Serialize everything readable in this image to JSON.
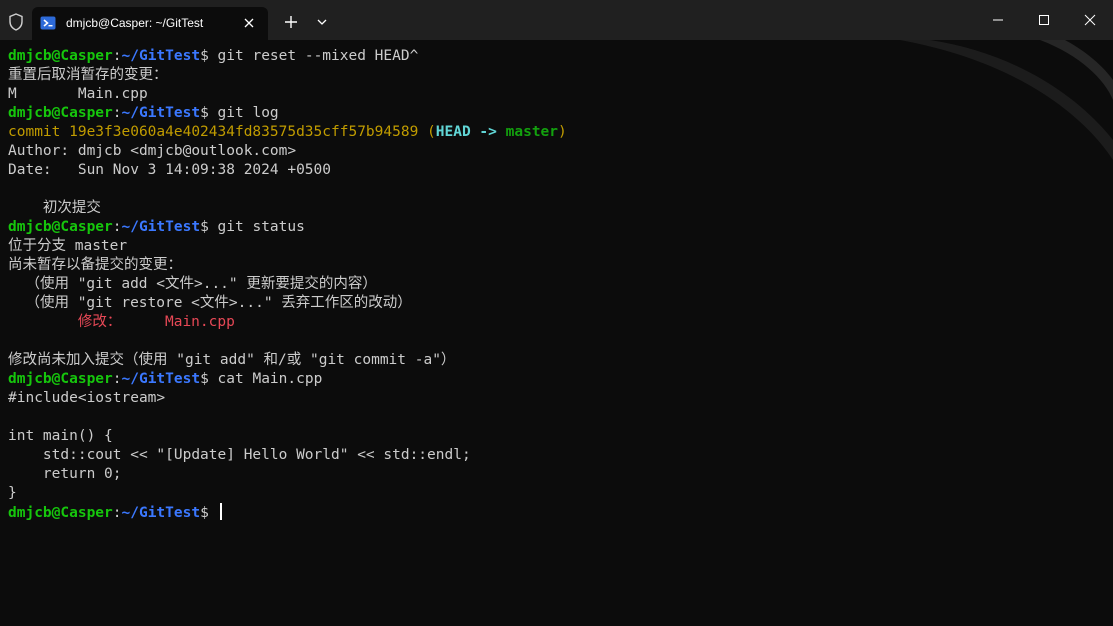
{
  "window": {
    "tab_title": "dmjcb@Casper: ~/GitTest",
    "icons": {
      "shield": "shield-icon",
      "tab": "powershell-icon",
      "tab_close": "close-icon",
      "new_tab": "plus-icon",
      "dropdown": "chevron-down-icon",
      "minimize": "minimize-icon",
      "maximize": "maximize-icon",
      "close": "close-icon"
    },
    "colors": {
      "titlebar": "#202020",
      "background": "#0c0c0c",
      "user_host": "#16c60c",
      "path": "#3b78ff",
      "commit": "#c19c00",
      "head": "#61d6d6",
      "branch": "#13a10e",
      "modified": "#e74856"
    }
  },
  "prompt": {
    "user_host": "dmjcb@Casper",
    "sep": ":",
    "path": "~/GitTest",
    "symbol": "$"
  },
  "session": {
    "cmd1": " git reset --mixed HEAD^",
    "out1_1": "重置后取消暂存的变更：",
    "out1_2": "M       Main.cpp",
    "cmd2": " git log",
    "commit_label": "commit ",
    "commit_hash": "19e3f3e060a4e402434fd83575d35cff57b94589",
    "paren_open": " (",
    "head": "HEAD -> ",
    "branch": "master",
    "paren_close": ")",
    "author": "Author: dmjcb <dmjcb@outlook.com>",
    "date": "Date:   Sun Nov 3 14:09:38 2024 +0500",
    "blank1": "",
    "message": "    初次提交",
    "cmd3": " git status",
    "status1": "位于分支 master",
    "status2": "尚未暂存以备提交的变更：",
    "status3": "  （使用 \"git add <文件>...\" 更新要提交的内容）",
    "status4": "  （使用 \"git restore <文件>...\" 丢弃工作区的改动）",
    "modified_indent": "        ",
    "modified_label": "修改：     Main.cpp",
    "blank2": "",
    "status5": "修改尚未加入提交（使用 \"git add\" 和/或 \"git commit -a\"）",
    "cmd4": " cat Main.cpp",
    "code1": "#include<iostream>",
    "blank3": "",
    "code2": "int main() {",
    "code3": "    std::cout << \"[Update] Hello World\" << std::endl;",
    "code4": "    return 0;",
    "code5": "}",
    "cmd5": " "
  }
}
